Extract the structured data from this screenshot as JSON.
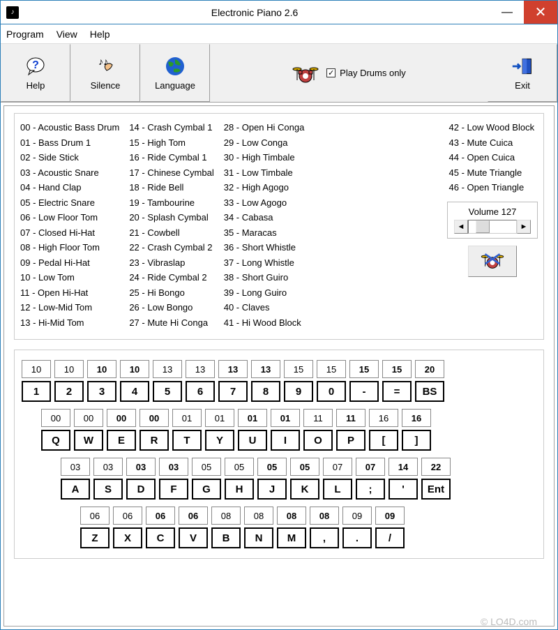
{
  "titlebar": {
    "title": "Electronic Piano 2.6"
  },
  "menu": {
    "program": "Program",
    "view": "View",
    "help": "Help"
  },
  "toolbar": {
    "help": "Help",
    "silence": "Silence",
    "language": "Language",
    "exit": "Exit",
    "play_drums_only": "Play Drums only",
    "checked": "✓"
  },
  "drums": {
    "col1": [
      "00 - Acoustic Bass Drum",
      "01 - Bass Drum 1",
      "02 - Side Stick",
      "03 - Acoustic Snare",
      "04 - Hand Clap",
      "05 - Electric Snare",
      "06 - Low Floor Tom",
      "07 - Closed Hi-Hat",
      "08 - High Floor Tom",
      "09 - Pedal Hi-Hat",
      "10 - Low Tom",
      "11 - Open Hi-Hat",
      "12 - Low-Mid Tom",
      "13 - Hi-Mid Tom"
    ],
    "col2": [
      "14 - Crash Cymbal 1",
      "15 - High Tom",
      "16 - Ride Cymbal 1",
      "17 - Chinese Cymbal",
      "18 - Ride Bell",
      "19 - Tambourine",
      "20 - Splash Cymbal",
      "21 - Cowbell",
      "22 - Crash Cymbal 2",
      "23 - Vibraslap",
      "24 - Ride Cymbal 2",
      "25 - Hi Bongo",
      "26 - Low Bongo",
      "27 - Mute Hi Conga"
    ],
    "col3": [
      "28 - Open Hi Conga",
      "29 - Low Conga",
      "30 - High Timbale",
      "31 - Low Timbale",
      "32 - High Agogo",
      "33 - Low Agogo",
      "34 - Cabasa",
      "35 - Maracas",
      "36 - Short Whistle",
      "37 - Long Whistle",
      "38 - Short Guiro",
      "39 - Long Guiro",
      "40 - Claves",
      "41 - Hi Wood Block"
    ],
    "col4": [
      "42 - Low Wood Block",
      "43 - Mute Cuica",
      "44 - Open Cuica",
      "45 - Mute Triangle",
      "46 - Open Triangle"
    ]
  },
  "volume": {
    "label": "Volume 127",
    "left": "◄",
    "right": "►"
  },
  "keyboard": {
    "row1": [
      {
        "num": "10",
        "bold": false,
        "key": "1"
      },
      {
        "num": "10",
        "bold": false,
        "key": "2"
      },
      {
        "num": "10",
        "bold": true,
        "key": "3"
      },
      {
        "num": "10",
        "bold": true,
        "key": "4"
      },
      {
        "num": "13",
        "bold": false,
        "key": "5"
      },
      {
        "num": "13",
        "bold": false,
        "key": "6"
      },
      {
        "num": "13",
        "bold": true,
        "key": "7"
      },
      {
        "num": "13",
        "bold": true,
        "key": "8"
      },
      {
        "num": "15",
        "bold": false,
        "key": "9"
      },
      {
        "num": "15",
        "bold": false,
        "key": "0"
      },
      {
        "num": "15",
        "bold": true,
        "key": "-"
      },
      {
        "num": "15",
        "bold": true,
        "key": "="
      },
      {
        "num": "20",
        "bold": true,
        "key": "BS"
      }
    ],
    "row2": [
      {
        "num": "00",
        "bold": false,
        "key": "Q"
      },
      {
        "num": "00",
        "bold": false,
        "key": "W"
      },
      {
        "num": "00",
        "bold": true,
        "key": "E"
      },
      {
        "num": "00",
        "bold": true,
        "key": "R"
      },
      {
        "num": "01",
        "bold": false,
        "key": "T"
      },
      {
        "num": "01",
        "bold": false,
        "key": "Y"
      },
      {
        "num": "01",
        "bold": true,
        "key": "U"
      },
      {
        "num": "01",
        "bold": true,
        "key": "I"
      },
      {
        "num": "11",
        "bold": false,
        "key": "O"
      },
      {
        "num": "11",
        "bold": true,
        "key": "P"
      },
      {
        "num": "16",
        "bold": false,
        "key": "["
      },
      {
        "num": "16",
        "bold": true,
        "key": "]"
      }
    ],
    "row3": [
      {
        "num": "03",
        "bold": false,
        "key": "A"
      },
      {
        "num": "03",
        "bold": false,
        "key": "S"
      },
      {
        "num": "03",
        "bold": true,
        "key": "D"
      },
      {
        "num": "03",
        "bold": true,
        "key": "F"
      },
      {
        "num": "05",
        "bold": false,
        "key": "G"
      },
      {
        "num": "05",
        "bold": false,
        "key": "H"
      },
      {
        "num": "05",
        "bold": true,
        "key": "J"
      },
      {
        "num": "05",
        "bold": true,
        "key": "K"
      },
      {
        "num": "07",
        "bold": false,
        "key": "L"
      },
      {
        "num": "07",
        "bold": true,
        "key": ";"
      },
      {
        "num": "14",
        "bold": true,
        "key": "'"
      },
      {
        "num": "22",
        "bold": true,
        "key": "Ent"
      }
    ],
    "row4": [
      {
        "num": "06",
        "bold": false,
        "key": "Z"
      },
      {
        "num": "06",
        "bold": false,
        "key": "X"
      },
      {
        "num": "06",
        "bold": true,
        "key": "C"
      },
      {
        "num": "06",
        "bold": true,
        "key": "V"
      },
      {
        "num": "08",
        "bold": false,
        "key": "B"
      },
      {
        "num": "08",
        "bold": false,
        "key": "N"
      },
      {
        "num": "08",
        "bold": true,
        "key": "M"
      },
      {
        "num": "08",
        "bold": true,
        "key": ","
      },
      {
        "num": "09",
        "bold": false,
        "key": "."
      },
      {
        "num": "09",
        "bold": true,
        "key": "/"
      }
    ]
  },
  "watermark": "© LO4D.com"
}
